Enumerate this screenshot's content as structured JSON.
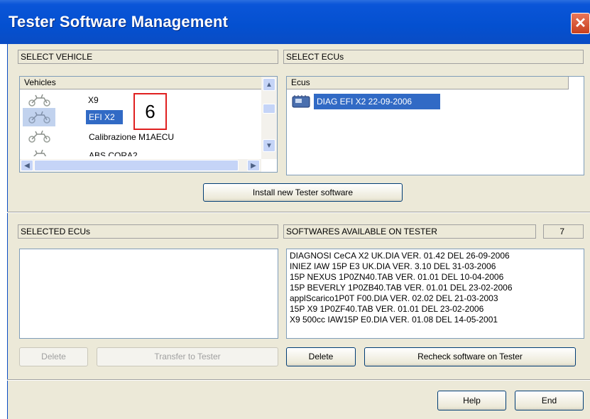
{
  "window": {
    "title": "Tester Software Management",
    "close_glyph": "✕"
  },
  "select_vehicle": {
    "header": "SELECT VEHICLE",
    "column": "Vehicles",
    "items": [
      {
        "label": "X9",
        "selected": false
      },
      {
        "label": "EFI X2",
        "selected": true
      },
      {
        "label": "Calibrazione M1AECU",
        "selected": false
      },
      {
        "label": "ABS CORA2",
        "selected": false
      }
    ]
  },
  "annotation": {
    "number": "6",
    "color": "#e02020"
  },
  "select_ecus": {
    "header": "SELECT ECUs",
    "column": "Ecus",
    "items": [
      {
        "label": "DIAG EFI X2 22-09-2006",
        "selected": true
      }
    ]
  },
  "install_button": "Install new Tester software",
  "selected_ecus": {
    "header": "SELECTED ECUs"
  },
  "softwares": {
    "header": "SOFTWARES AVAILABLE ON TESTER",
    "count": "7",
    "items": [
      "DIAGNOSI CeCA X2 UK.DIA VER. 01.42 DEL 26-09-2006",
      "INIEZ IAW 15P E3 UK.DIA VER. 3.10 DEL 31-03-2006",
      "15P NEXUS 1P0ZN40.TAB VER. 01.01 DEL 10-04-2006",
      "15P BEVERLY 1P0ZB40.TAB VER. 01.01 DEL 23-02-2006",
      "applScarico1P0T F00.DIA VER. 02.02 DEL 21-03-2003",
      "15P X9 1P0ZF40.TAB VER. 01.01 DEL 23-02-2006",
      "X9 500cc IAW15P E0.DIA VER. 01.08 DEL 14-05-2001"
    ]
  },
  "buttons": {
    "delete_left": "Delete",
    "transfer": "Transfer to Tester",
    "delete_right": "Delete",
    "recheck": "Recheck software on Tester",
    "help": "Help",
    "end": "End"
  },
  "colors": {
    "selection": "#316ac5",
    "titlebar": "#0450d0",
    "panel": "#ece9d8"
  },
  "icons": [
    "motorcycle-icon",
    "ecu-chip-icon",
    "scroll-up-icon",
    "scroll-down-icon",
    "scroll-left-icon",
    "scroll-right-icon"
  ]
}
